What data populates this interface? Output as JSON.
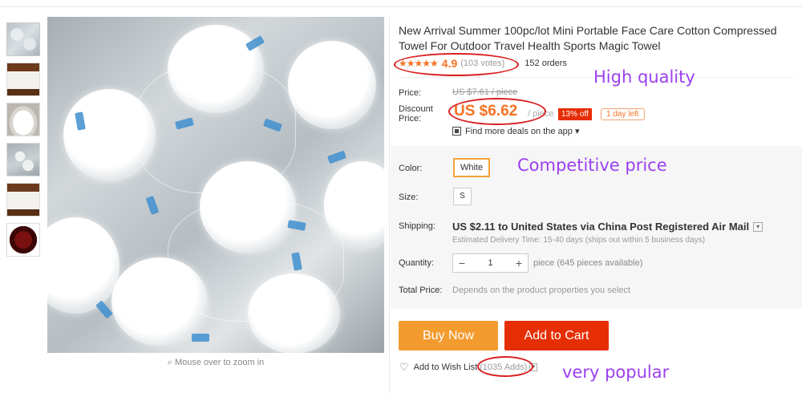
{
  "product": {
    "title": "New Arrival Summer 100pc/lot Mini Portable Face Care Cotton Compressed Towel For Outdoor Travel Health Sports Magic Towel",
    "rating_stars": "★★★★★",
    "rating_score": "4.9",
    "rating_votes": "(103 votes)",
    "orders": "152 orders"
  },
  "price": {
    "price_label": "Price:",
    "old_price": "US $7.61 / piece",
    "discount_label_1": "Discount",
    "discount_label_2": "Price:",
    "current_price": "US $6.62",
    "per_piece": "/ piece",
    "off_badge": "13% off",
    "time_left": "1 day left",
    "app_deals": "Find more deals on the app ▾"
  },
  "sku": {
    "color_label": "Color:",
    "color_value": "White",
    "size_label": "Size:",
    "size_value": "S",
    "shipping_label": "Shipping:",
    "shipping_text": "US $2.11 to United States via China Post Registered Air Mail",
    "delivery_text": "Estimated Delivery Time: 15-40 days (ships out within 5 business days)",
    "quantity_label": "Quantity:",
    "quantity_minus": "−",
    "quantity_value": "1",
    "quantity_plus": "+",
    "availability": "piece (645 pieces available)",
    "total_label": "Total Price:",
    "total_note": "Depends on the product properties you select"
  },
  "actions": {
    "buy_now": "Buy Now",
    "add_to_cart": "Add to Cart",
    "wish_list": "Add to Wish List",
    "wish_adds": "(1035 Adds)"
  },
  "gallery": {
    "zoom_hint": "Mouse over to zoom in"
  },
  "annotations": {
    "quality": "High quality",
    "price": "Competitive price",
    "popular": "very popular",
    "color": "#9b3ff0",
    "oval_color": "#d81f1f"
  },
  "colors": {
    "accent_orange": "#f57224",
    "buy_button": "#f39b2f",
    "cart_button": "#e62e04"
  }
}
